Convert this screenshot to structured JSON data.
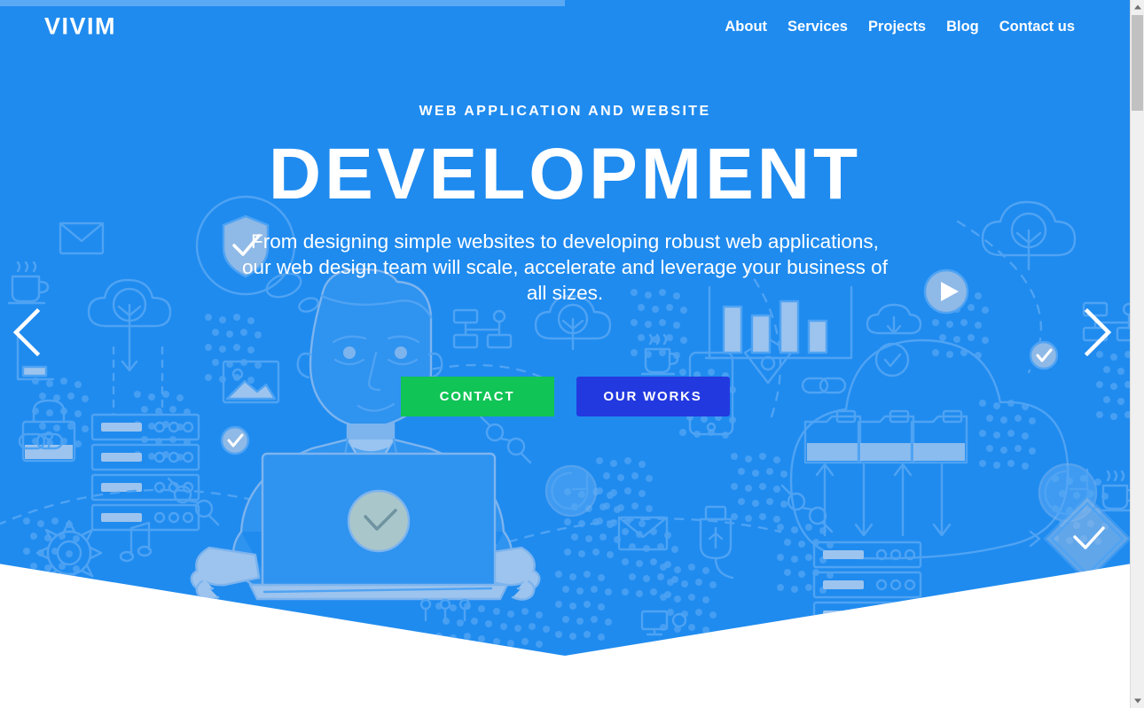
{
  "browser": {
    "progress_percent": 50
  },
  "header": {
    "logo": "VIVIM",
    "nav": [
      {
        "label": "About",
        "name": "nav-link-about"
      },
      {
        "label": "Services",
        "name": "nav-link-services"
      },
      {
        "label": "Projects",
        "name": "nav-link-projects"
      },
      {
        "label": "Blog",
        "name": "nav-link-blog"
      },
      {
        "label": "Contact us",
        "name": "nav-link-contact-us"
      }
    ]
  },
  "hero": {
    "eyebrow": "WEB APPLICATION AND WEBSITE",
    "headline": "DEVELOPMENT",
    "subcopy": "From designing simple websites to developing robust web applications, our web design team will scale, accelerate and leverage your business of all sizes.",
    "buttons": {
      "primary": {
        "label": "CONTACT",
        "color": "#10c455"
      },
      "secondary": {
        "label": "OUR WORKS",
        "color": "#2339e0"
      }
    },
    "carousel": {
      "prev_icon": "chevron-left-icon",
      "next_icon": "chevron-right-icon"
    },
    "illustration_icons": [
      "envelope-icon",
      "coffee-cup-icon",
      "cloud-icon",
      "server-rack-icon",
      "padlock-icon",
      "link-chain-icon",
      "gear-icon",
      "music-note-icon",
      "photo-icon",
      "shield-check-icon",
      "sitemap-icon",
      "play-button-icon",
      "cloud-download-icon",
      "folder-icon",
      "refresh-icon",
      "usb-plug-icon",
      "checkmark-circle-icon",
      "bar-chart-icon",
      "arrow-up-icon",
      "arrow-down-icon",
      "diamond-check-icon",
      "man-with-laptop-illustration"
    ]
  },
  "colors": {
    "brand_blue": "#1f8bef",
    "progress_blue": "#5aa9f5",
    "green": "#10c455",
    "deep_blue": "#2339e0",
    "page_background": "#ffffff"
  },
  "scrollbar": {
    "up_icon": "scroll-up-arrow-icon",
    "down_icon": "scroll-down-arrow-icon"
  }
}
